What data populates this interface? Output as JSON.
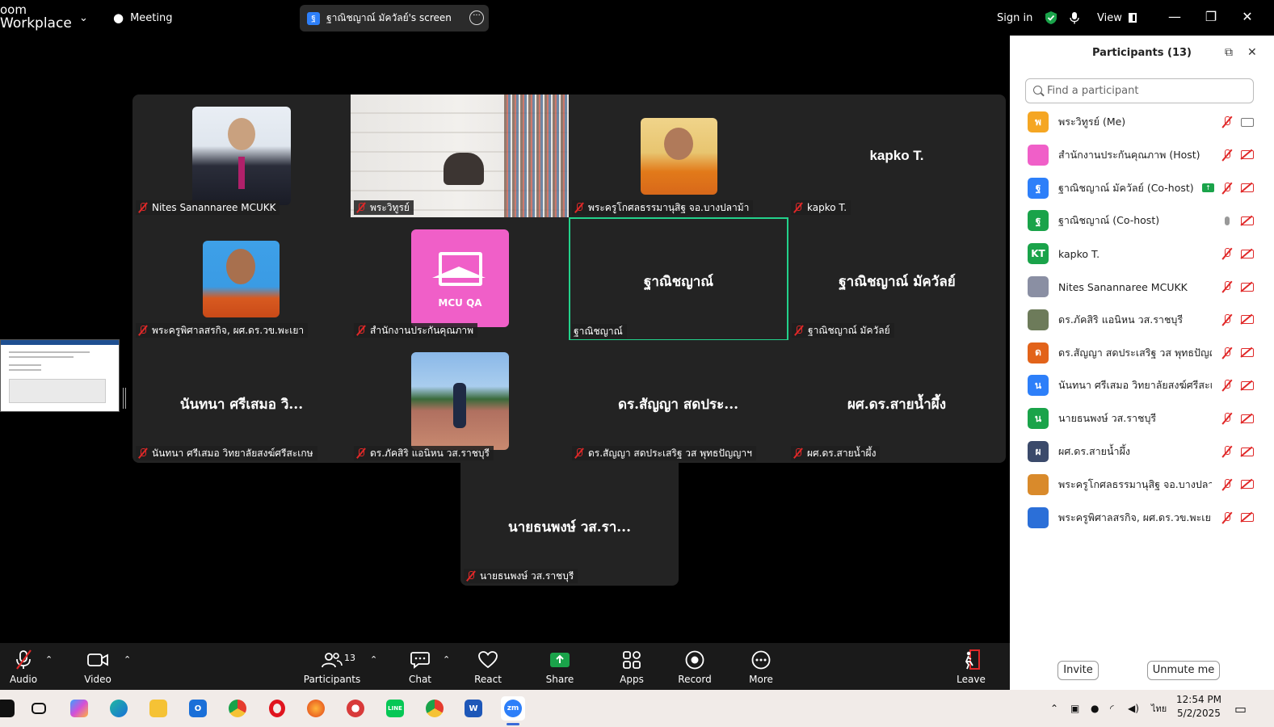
{
  "app": {
    "brand_line1": "oom",
    "brand_line2": "Workplace"
  },
  "topbar": {
    "meeting_label": "Meeting",
    "share_title": "ฐาณิชญาณ์ มัควัลย์'s screen",
    "sign_in": "Sign in",
    "view_label": "View"
  },
  "tiles": [
    {
      "label": "Nites Sanannaree MCUKK"
    },
    {
      "label": "พระวิทูรย์"
    },
    {
      "label": "พระครูโกศลธรรมานุสิฐ จอ.บางปลาม้า"
    },
    {
      "big": "kapko T.",
      "label": "kapko T."
    },
    {
      "label": "พระครูพิศาลสรกิจ, ผศ.ดร.วข.พะเยา"
    },
    {
      "logo_text": "MCU QA",
      "label": "สำนักงานประกันคุณภาพ"
    },
    {
      "big": "ฐาณิชญาณ์",
      "label": "ฐาณิชญาณ์"
    },
    {
      "big": "ฐาณิชญาณ์ มัควัลย์",
      "label": "ฐาณิชญาณ์ มัควัลย์"
    },
    {
      "big": "นันทนา ศรีเสมอ วิ...",
      "label": "นันทนา ศรีเสมอ วิทยาลัยสงฆ์ศรีสะเกษ"
    },
    {
      "label": "ดร.ภัคสิริ แอนิหน วส.ราชบุรี"
    },
    {
      "big": "ดร.สัญญา สดประ...",
      "label": "ดร.สัญญา สดประเสริฐ วส พุทธปัญญาฯ"
    },
    {
      "big": "ผศ.ดร.สายน้ำผึ้ง",
      "label": "ผศ.ดร.สายน้ำผึ้ง"
    },
    {
      "big": "นายธนพงษ์ วส.รา...",
      "label": "นายธนพงษ์ วส.ราชบุรี"
    }
  ],
  "toolbar": {
    "audio": "Audio",
    "video": "Video",
    "participants": "Participants",
    "participants_count": "13",
    "chat": "Chat",
    "react": "React",
    "share": "Share",
    "apps": "Apps",
    "record": "Record",
    "more": "More",
    "leave": "Leave"
  },
  "panel": {
    "title": "Participants (13)",
    "search_placeholder": "Find a participant",
    "invite": "Invite",
    "unmute_me": "Unmute me",
    "participants": [
      {
        "initial": "พ",
        "color": "#f5a623",
        "name": "พระวิทูรย์ (Me)",
        "cam": "on"
      },
      {
        "initial": "",
        "color": "#f05fc8",
        "name": "สำนักงานประกันคุณภาพ (Host)",
        "cam": "off"
      },
      {
        "initial": "ฐ",
        "color": "#2d7ff9",
        "name": "ฐาณิชญาณ์ มัควัลย์ (Co-host)",
        "cam": "off",
        "sharing": true
      },
      {
        "initial": "ฐ",
        "color": "#1aa34a",
        "name": "ฐาณิชญาณ์ (Co-host)",
        "cam": "off",
        "mic": "on"
      },
      {
        "initial": "KT",
        "color": "#1aa34a",
        "name": "kapko T.",
        "cam": "off"
      },
      {
        "initial": "",
        "color": "#8a8fa3",
        "name": "Nites Sanannaree MCUKK",
        "cam": "off"
      },
      {
        "initial": "",
        "color": "#6d7b5a",
        "name": "ดร.ภัคสิริ แอนิหน วส.ราชบุรี",
        "cam": "off"
      },
      {
        "initial": "ด",
        "color": "#e2631a",
        "name": "ดร.สัญญา สดประเสริฐ วส พุทธปัญญาฯ",
        "cam": "off"
      },
      {
        "initial": "น",
        "color": "#2d7ff9",
        "name": "นันทนา ศรีเสมอ วิทยาลัยสงฆ์ศรีสะเกษ",
        "cam": "off"
      },
      {
        "initial": "น",
        "color": "#1aa34a",
        "name": "นายธนพงษ์ วส.ราชบุรี",
        "cam": "off"
      },
      {
        "initial": "ผ",
        "color": "#3b4a6b",
        "name": "ผศ.ดร.สายน้ำผึ้ง",
        "cam": "off"
      },
      {
        "initial": "",
        "color": "#d98a2b",
        "name": "พระครูโกศลธรรมานุสิฐ จอ.บางปลาม้า",
        "cam": "off"
      },
      {
        "initial": "",
        "color": "#2b6fd8",
        "name": "พระครูพิศาลสรกิจ, ผศ.ดร.วข.พะเยา",
        "cam": "off"
      }
    ]
  },
  "taskbar": {
    "lang": "ไทย",
    "time": "12:54 PM",
    "date": "5/2/2025"
  }
}
